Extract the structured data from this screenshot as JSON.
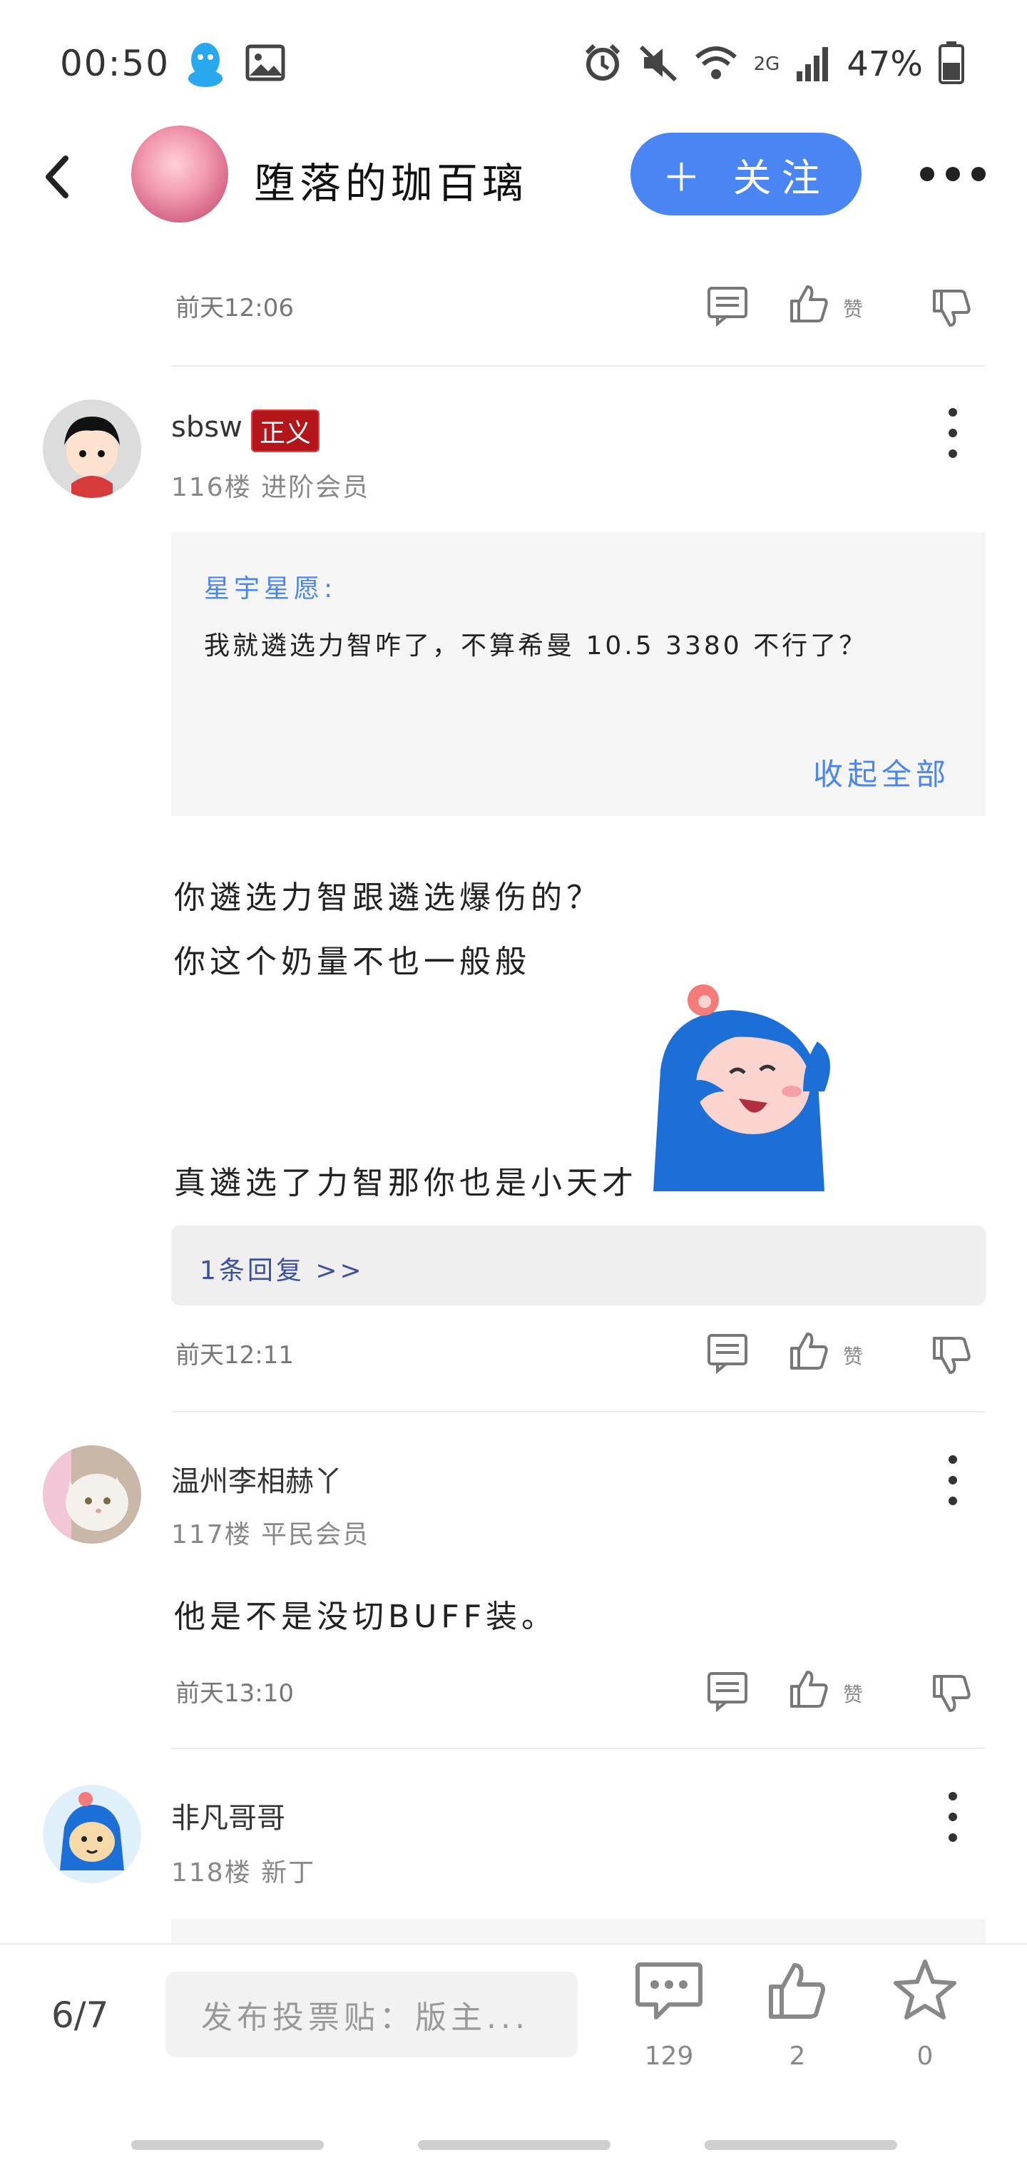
{
  "status_bar": {
    "time": "00:50",
    "network": "2G",
    "battery": "47%",
    "icons": [
      "qq-icon",
      "gallery-icon",
      "alarm-icon",
      "mute-icon",
      "wifi-icon",
      "signal-icon",
      "battery-icon"
    ]
  },
  "header": {
    "author_name": "堕落的珈百璃",
    "follow_label": "＋ 关注"
  },
  "posts": [
    {
      "time": "前天12:06",
      "like_label": "赞"
    },
    {
      "username": "sbsw",
      "badge": "正义",
      "floor": "116楼 进阶会员",
      "quote_author": "星宇星愿:",
      "quote_text": "我就遴选力智咋了，不算希曼 10.5      3380      不行了？",
      "quote_collapse": "收起全部",
      "lines": [
        "你遴选力智跟遴选爆伤的？",
        "你这个奶量不也一般般",
        "真遴选了力智那你也是小天才"
      ],
      "reply_link": "1条回复 >>",
      "time": "前天12:11",
      "like_label": "赞"
    },
    {
      "username": "温州李相赫丫",
      "floor": "117楼 平民会员",
      "lines": [
        "他是不是没切BUFF装。"
      ],
      "time": "前天13:10",
      "like_label": "赞"
    },
    {
      "username": "非凡哥哥",
      "floor": "118楼 新丁"
    }
  ],
  "bottom_bar": {
    "page": "6/7",
    "compose_placeholder": "发布投票贴：版主...",
    "comment_count": "129",
    "like_count": "2",
    "favorite_count": "0"
  },
  "colors": {
    "accent": "#4a86f3",
    "badge": "#b3151b",
    "reply_link": "#3d4fa1"
  }
}
